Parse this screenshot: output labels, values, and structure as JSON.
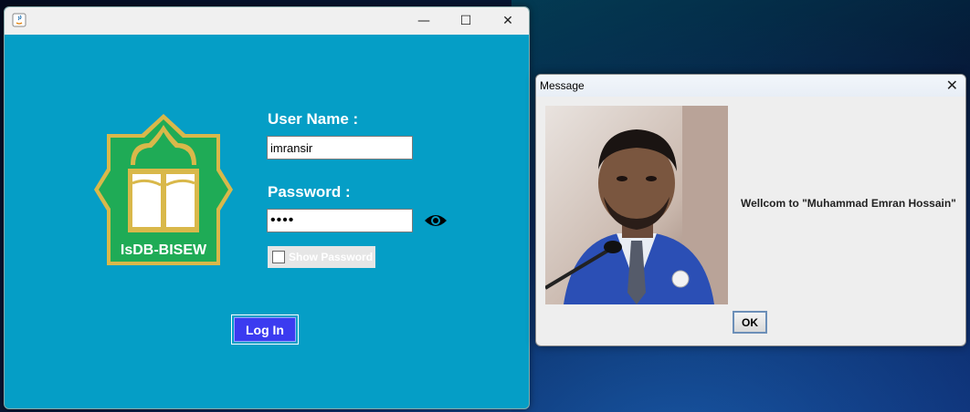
{
  "login_window": {
    "title_controls": {
      "minimize": "—",
      "maximize": "☐",
      "close": "✕"
    },
    "logo": {
      "text": "IsDB-BISEW",
      "frame_color": "#d9b84a",
      "field_color": "#1fab56"
    },
    "username_label": "User Name :",
    "username_value": "imransir",
    "password_label": "Password :",
    "password_value": "••••",
    "show_password_label": "Show Password",
    "show_password_checked": false,
    "login_button": "Log In",
    "background_color": "#059ec6",
    "button_color": "#3b3bf0"
  },
  "message_dialog": {
    "title": "Message",
    "close": "✕",
    "message": "Wellcom to \"Muhammad Emran Hossain\"",
    "ok_button": "OK"
  }
}
